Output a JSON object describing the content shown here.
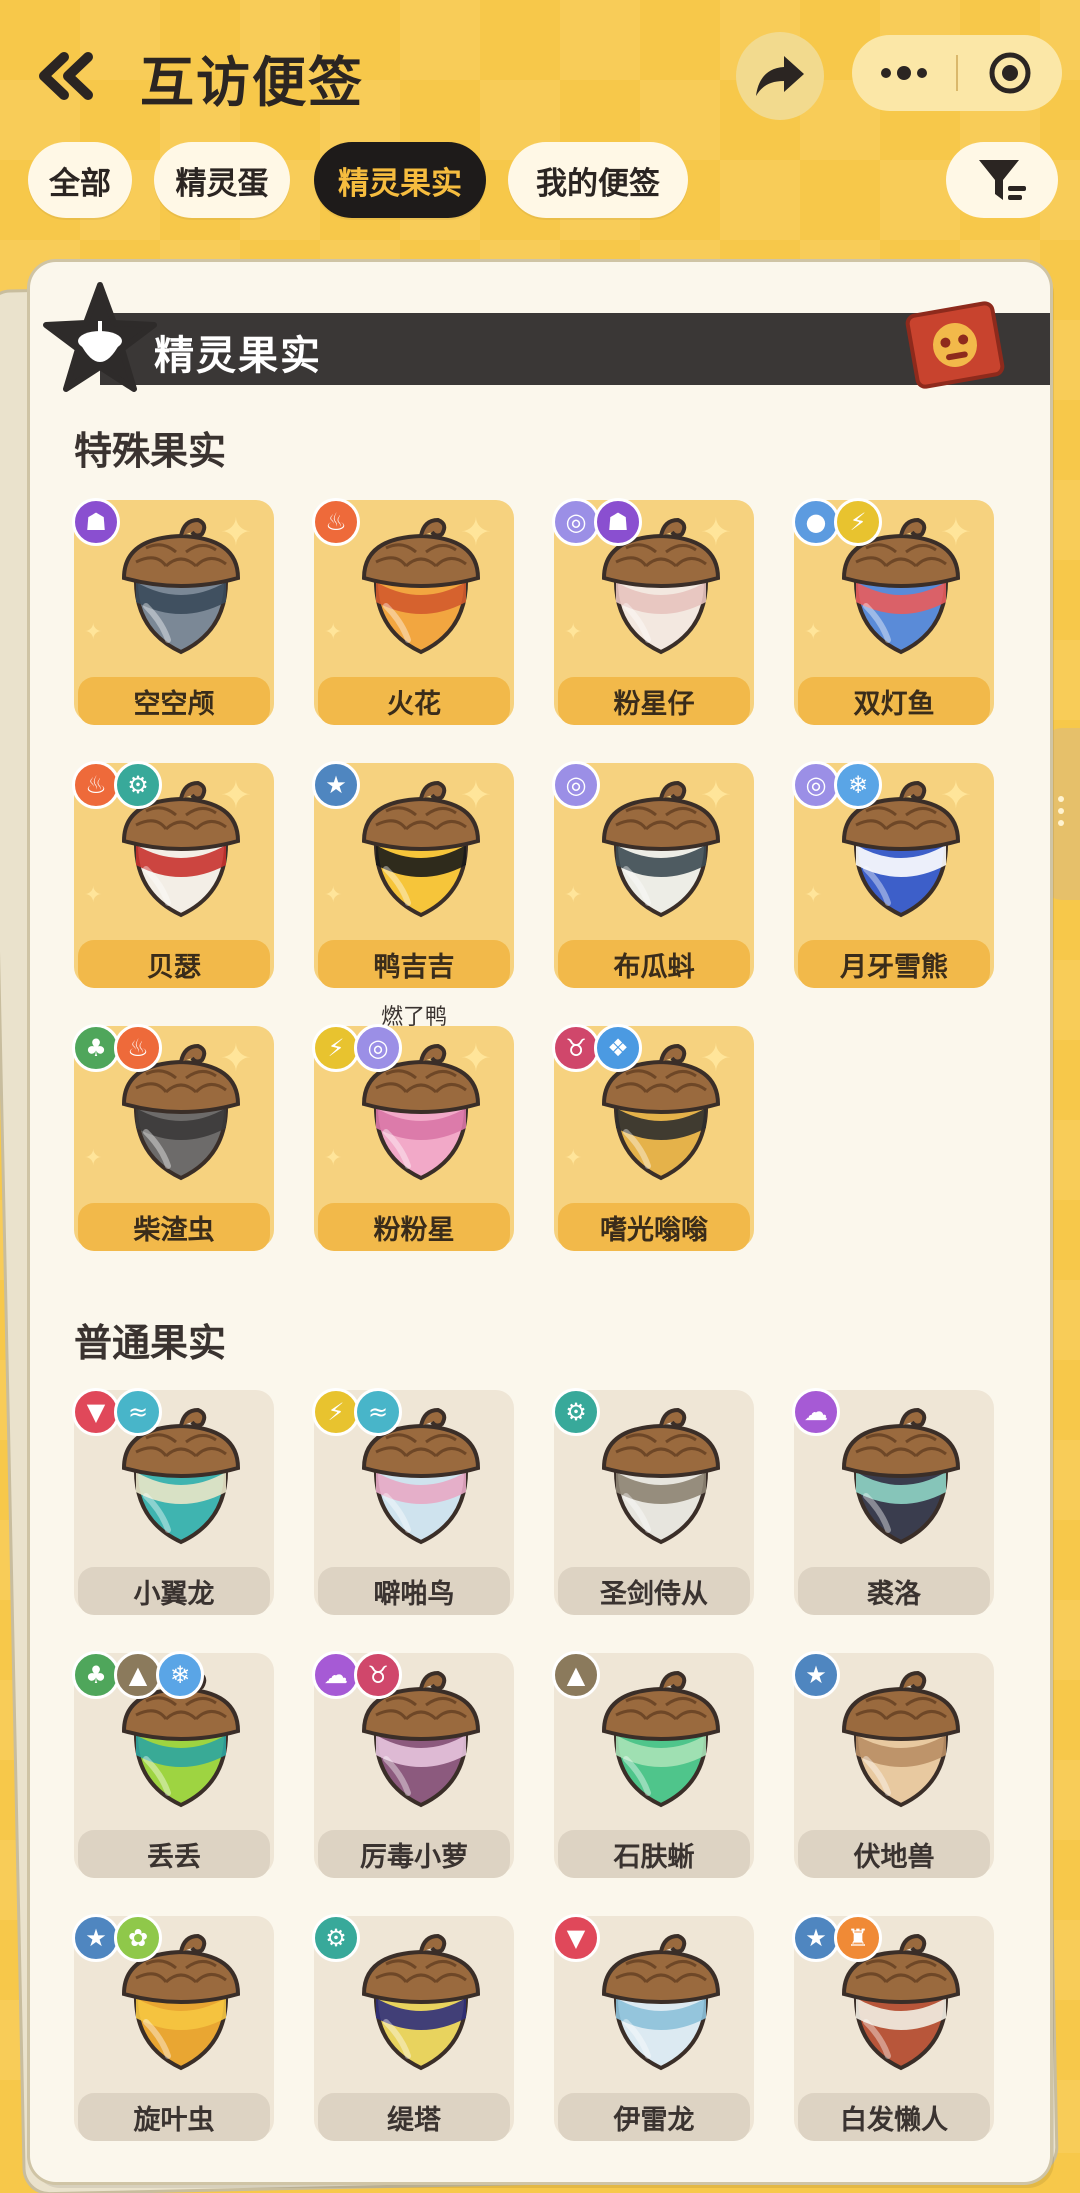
{
  "header": {
    "title": "互访便签"
  },
  "tabs": [
    {
      "label": "全部",
      "active": false
    },
    {
      "label": "精灵蛋",
      "active": false
    },
    {
      "label": "精灵果实",
      "active": true
    },
    {
      "label": "我的便签",
      "active": false
    }
  ],
  "card": {
    "banner_title": "精灵果实"
  },
  "special": {
    "title": "特殊果实",
    "items": [
      {
        "name": "空空颅",
        "badges": [
          "ghost"
        ],
        "shell": "#7B8896",
        "band": "#3A4A5A"
      },
      {
        "name": "火花",
        "badges": [
          "fire"
        ],
        "shell": "#F2A640",
        "band": "#D35B2C"
      },
      {
        "name": "粉星仔",
        "badges": [
          "psychic",
          "ghost"
        ],
        "shell": "#F3E8E0",
        "band": "#E7C3BE"
      },
      {
        "name": "双灯鱼",
        "badges": [
          "water",
          "electric"
        ],
        "shell": "#5A8BD8",
        "band": "#E85C5C"
      },
      {
        "name": "贝瑟",
        "badges": [
          "fire",
          "mechanical"
        ],
        "shell": "#F3EEE6",
        "band": "#C8322E"
      },
      {
        "name": "鸭吉吉",
        "badges": [
          "normal"
        ],
        "shell": "#F6C53A",
        "band": "#1A1A1A",
        "nickname": "燃了鸭"
      },
      {
        "name": "布瓜蚪",
        "badges": [
          "psychic"
        ],
        "shell": "#EDEDE6",
        "band": "#3C4A52"
      },
      {
        "name": "月牙雪熊",
        "badges": [
          "psychic",
          "ice"
        ],
        "shell": "#3D5FC9",
        "band": "#FFFFFF"
      },
      {
        "name": "柴渣虫",
        "badges": [
          "grass",
          "fire"
        ],
        "shell": "#6D6B6A",
        "band": "#3B3A3A"
      },
      {
        "name": "粉粉星",
        "badges": [
          "electric",
          "psychic"
        ],
        "shell": "#F2A9C8",
        "band": "#D976A6"
      },
      {
        "name": "嗜光嗡嗡",
        "badges": [
          "demon",
          "ice2"
        ],
        "shell": "#E5B24A",
        "band": "#2E2E2E"
      }
    ]
  },
  "normal": {
    "title": "普通果实",
    "items": [
      {
        "name": "小翼龙",
        "badges": [
          "dragon",
          "wing"
        ],
        "shell": "#3FB4B0",
        "band": "#E9E6C8"
      },
      {
        "name": "噼啪鸟",
        "badges": [
          "electric",
          "wing"
        ],
        "shell": "#CFE3EE",
        "band": "#E7A9C4"
      },
      {
        "name": "圣剑侍从",
        "badges": [
          "mechanical"
        ],
        "shell": "#E7E5DE",
        "band": "#8D8372"
      },
      {
        "name": "裘洛",
        "badges": [
          "poison"
        ],
        "shell": "#3A3D4E",
        "band": "#8FD4C5"
      },
      {
        "name": "丢丢",
        "badges": [
          "grass",
          "ground",
          "ice"
        ],
        "shell": "#9ED441",
        "band": "#2EA5A0"
      },
      {
        "name": "厉毒小萝",
        "badges": [
          "poison",
          "demon"
        ],
        "shell": "#8C5A7E",
        "band": "#E7C4DE"
      },
      {
        "name": "石肤蜥",
        "badges": [
          "ground"
        ],
        "shell": "#4FC58B",
        "band": "#A7E2B6"
      },
      {
        "name": "伏地兽",
        "badges": [
          "normal"
        ],
        "shell": "#E8C9A0",
        "band": "#B98E64"
      },
      {
        "name": "旋叶虫",
        "badges": [
          "normal",
          "bug"
        ],
        "shell": "#E9A632",
        "band": "#F6C740"
      },
      {
        "name": "缇塔",
        "badges": [
          "mechanical"
        ],
        "shell": "#E8D35E",
        "band": "#2F2F7A"
      },
      {
        "name": "伊雷龙",
        "badges": [
          "dragon"
        ],
        "shell": "#DCEAF2",
        "band": "#8CC1D9"
      },
      {
        "name": "白发懒人",
        "badges": [
          "normal",
          "fighting"
        ],
        "shell": "#B8563A",
        "band": "#F2EEE3"
      }
    ]
  },
  "badge_colors": {
    "ghost": "#8A4FD0",
    "fire": "#EE6A3A",
    "psychic": "#9B8FE6",
    "water": "#5C9BE0",
    "electric": "#E8C32F",
    "mechanical": "#38A99A",
    "normal": "#4F86C0",
    "grass": "#4FA65B",
    "ice": "#5AA5E6",
    "ice2": "#4B9AE2",
    "demon": "#D0476B",
    "dragon": "#E0485A",
    "wing": "#48B5C9",
    "poison": "#A65AD5",
    "ground": "#8B7A5C",
    "bug": "#8FC84A",
    "fighting": "#F08A36"
  }
}
